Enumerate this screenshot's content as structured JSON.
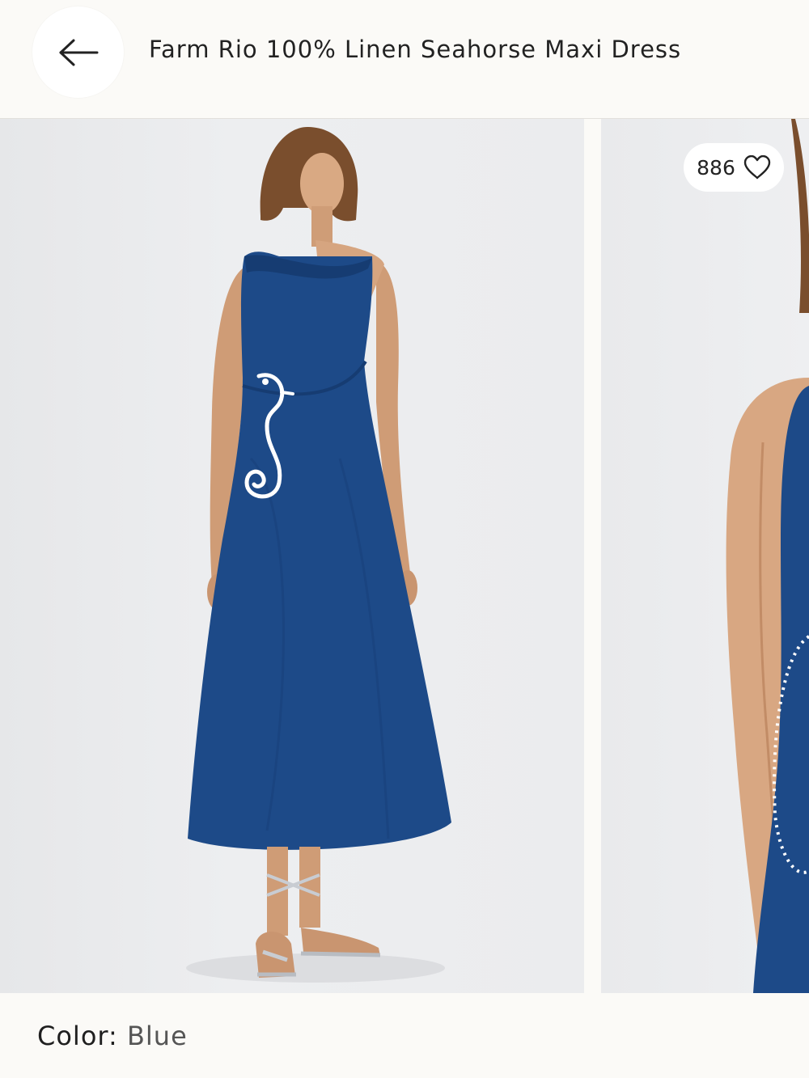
{
  "header": {
    "title": "Farm Rio 100% Linen Seahorse Maxi Dress",
    "back_icon": "arrow-left-icon"
  },
  "gallery": {
    "like_count": "886",
    "like_icon": "heart-outline-icon",
    "dress_color": "#1d4a88",
    "photos": [
      {
        "alt": "front view"
      },
      {
        "alt": "side view"
      }
    ]
  },
  "product": {
    "color_label": "Color:",
    "color_value": "Blue"
  }
}
